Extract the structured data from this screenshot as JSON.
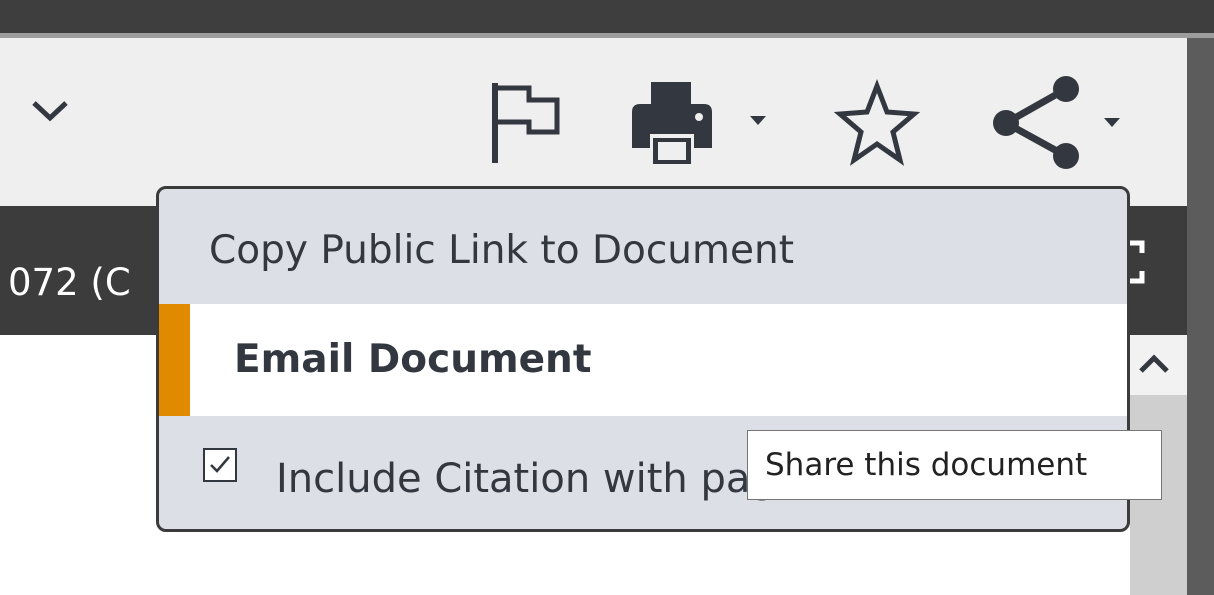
{
  "docbar": {
    "title": "072 (C"
  },
  "share_menu": {
    "items": [
      {
        "label": "Copy Public Link to Document"
      },
      {
        "label": "Email Document",
        "active": true
      },
      {
        "label": "Include Citation with page",
        "checked": true
      }
    ]
  },
  "tooltip": {
    "text": "Share this document"
  },
  "icons": {
    "collapse": "chevron-down-icon",
    "flag": "flag-icon",
    "print": "printer-icon",
    "favorite": "star-icon",
    "share": "share-icon",
    "expand": "expand-icon",
    "scroll_up": "chevron-up-icon",
    "checkbox": "checkmark-icon"
  },
  "colors": {
    "accent": "#e08a00",
    "popup_bg": "#dcdfe5",
    "header_dark": "#3c3c3c",
    "toolbar_bg": "#efefef"
  }
}
